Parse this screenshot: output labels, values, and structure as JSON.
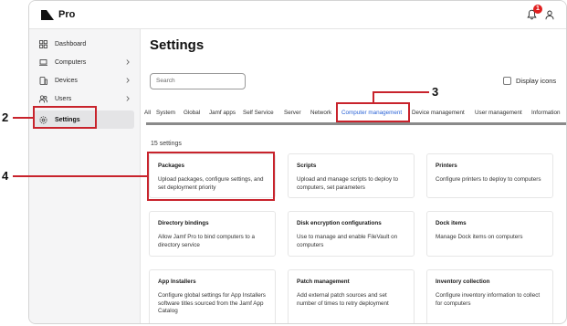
{
  "app": {
    "name": "Pro",
    "notification_count": "1"
  },
  "sidebar": {
    "items": [
      {
        "label": "Dashboard",
        "icon": "dashboard-icon",
        "chevron": false
      },
      {
        "label": "Computers",
        "icon": "computer-icon",
        "chevron": true
      },
      {
        "label": "Devices",
        "icon": "device-icon",
        "chevron": true
      },
      {
        "label": "Users",
        "icon": "users-icon",
        "chevron": true
      },
      {
        "label": "Settings",
        "icon": "gear-icon",
        "chevron": false,
        "active": true
      }
    ]
  },
  "main": {
    "title": "Settings",
    "search_placeholder": "Search",
    "display_icons_label": "Display icons",
    "tabs": [
      "All",
      "System",
      "Global",
      "Jamf apps",
      "Self Service",
      "Server",
      "Network",
      "Computer management",
      "Device management",
      "User management",
      "Information"
    ],
    "active_tab": "Computer management",
    "count_label": "15 settings",
    "cards": [
      {
        "title": "Packages",
        "desc": "Upload packages, configure settings, and set deployment priority"
      },
      {
        "title": "Scripts",
        "desc": "Upload and manage scripts to deploy to computers, set parameters"
      },
      {
        "title": "Printers",
        "desc": "Configure printers to deploy to computers"
      },
      {
        "title": "Directory bindings",
        "desc": "Allow Jamf Pro to bind computers to a directory service"
      },
      {
        "title": "Disk encryption configurations",
        "desc": "Use to manage and enable FileVault on computers"
      },
      {
        "title": "Dock items",
        "desc": "Manage Dock items on computers"
      },
      {
        "title": "App Installers",
        "desc": "Configure global settings for App Installers software titles sourced from the Jamf App Catalog"
      },
      {
        "title": "Patch management",
        "desc": "Add external patch sources and set number of times to retry deployment"
      },
      {
        "title": "Inventory collection",
        "desc": "Configure inventory information to collect for computers"
      }
    ]
  },
  "callouts": {
    "settings": "2",
    "tab": "3",
    "packages": "4"
  },
  "colors": {
    "accent": "#2a62d6",
    "callout": "#c8232c",
    "badge": "#e02020"
  }
}
